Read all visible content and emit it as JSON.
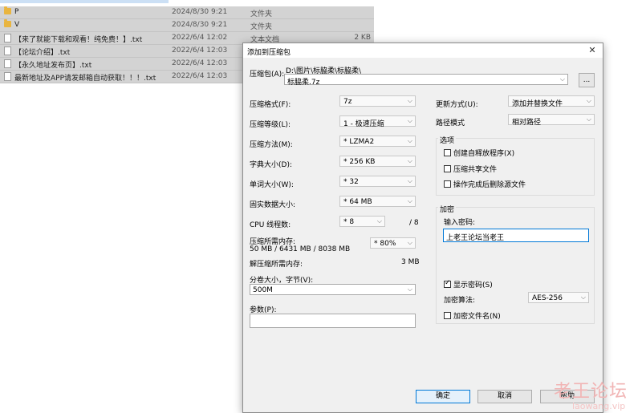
{
  "explorer": {
    "rows": [
      {
        "name": "P",
        "date": "2024/8/30 9:21",
        "type": "文件夹",
        "size": "",
        "icon": "folder-icon"
      },
      {
        "name": "V",
        "date": "2024/8/30 9:21",
        "type": "文件夹",
        "size": "",
        "icon": "folder-icon"
      },
      {
        "name": "【来了就能下载和观看！纯免费！】.txt",
        "date": "2022/6/4 12:02",
        "type": "文本文档",
        "size": "2 KB",
        "icon": "file-icon"
      },
      {
        "name": "【论坛介绍】.txt",
        "date": "2022/6/4 12:03",
        "type": "",
        "size": "",
        "icon": "file-icon"
      },
      {
        "name": "【永久地址发布页】.txt",
        "date": "2022/6/4 12:03",
        "type": "",
        "size": "",
        "icon": "file-icon"
      },
      {
        "name": "最新地址及APP请发邮箱自动获取！！！.txt",
        "date": "2022/6/4 12:03",
        "type": "",
        "size": "",
        "icon": "file-icon"
      }
    ]
  },
  "dialog": {
    "title": "添加到压缩包",
    "archive_label": "压缩包(A):",
    "archive_path": "D:\\图片\\标脇柔\\标脇柔\\",
    "archive_name": "标脇柔.7z",
    "browse_label": "...",
    "left": {
      "format_label": "压缩格式(F):",
      "format_value": "7z",
      "level_label": "压缩等级(L):",
      "level_value": "1 - 极速压缩",
      "method_label": "压缩方法(M):",
      "method_value": "* LZMA2",
      "dict_label": "字典大小(D):",
      "dict_value": "* 256 KB",
      "word_label": "单词大小(W):",
      "word_value": "* 32",
      "solid_label": "固实数据大小:",
      "solid_value": "* 64 MB",
      "cpu_label": "CPU 线程数:",
      "cpu_value": "* 8",
      "cpu_max": "/ 8",
      "mem_label": "压缩所需内存:",
      "mem_detail": "50 MB / 6431 MB / 8038 MB",
      "mem_value": "* 80%",
      "decomp_label": "解压缩所需内存:",
      "decomp_value": "3 MB",
      "split_label": "分卷大小，字节(V):",
      "split_value": "500M",
      "params_label": "参数(P):",
      "params_value": ""
    },
    "right": {
      "update_label": "更新方式(U):",
      "update_value": "添加并替换文件",
      "path_label": "路径模式",
      "path_value": "相对路径",
      "options_title": "选项",
      "opt_sfx": "创建自释放程序(X)",
      "opt_shared": "压缩共享文件",
      "opt_delete": "操作完成后删除源文件",
      "enc_title": "加密",
      "enc_pw_label": "输入密码:",
      "enc_pw_value": "上老王论坛当老王",
      "show_pw": "显示密码(S)",
      "enc_method_label": "加密算法:",
      "enc_method_value": "AES-256",
      "enc_names": "加密文件名(N)"
    },
    "buttons": {
      "ok": "确定",
      "cancel": "取消",
      "help": "帮助"
    }
  },
  "watermark": {
    "line1": "老王论坛",
    "line2": "laowang.vip"
  }
}
